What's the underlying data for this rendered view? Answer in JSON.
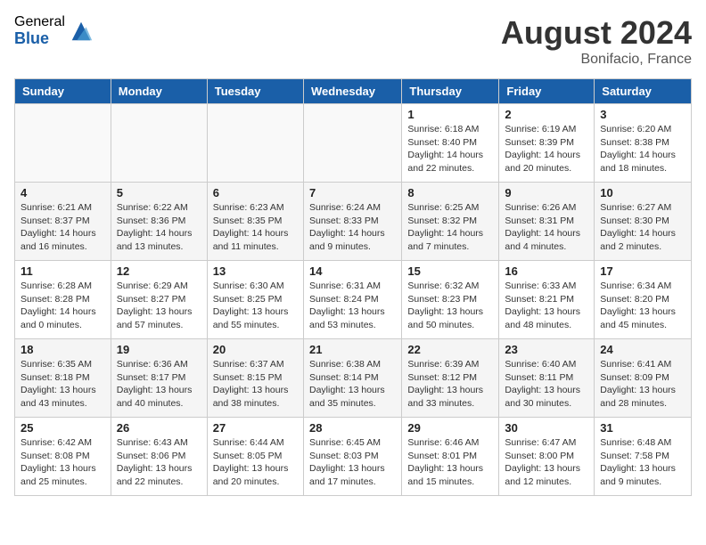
{
  "header": {
    "logo_general": "General",
    "logo_blue": "Blue",
    "month_year": "August 2024",
    "location": "Bonifacio, France"
  },
  "days_of_week": [
    "Sunday",
    "Monday",
    "Tuesday",
    "Wednesday",
    "Thursday",
    "Friday",
    "Saturday"
  ],
  "weeks": [
    [
      {
        "day": "",
        "info": ""
      },
      {
        "day": "",
        "info": ""
      },
      {
        "day": "",
        "info": ""
      },
      {
        "day": "",
        "info": ""
      },
      {
        "day": "1",
        "info": "Sunrise: 6:18 AM\nSunset: 8:40 PM\nDaylight: 14 hours\nand 22 minutes."
      },
      {
        "day": "2",
        "info": "Sunrise: 6:19 AM\nSunset: 8:39 PM\nDaylight: 14 hours\nand 20 minutes."
      },
      {
        "day": "3",
        "info": "Sunrise: 6:20 AM\nSunset: 8:38 PM\nDaylight: 14 hours\nand 18 minutes."
      }
    ],
    [
      {
        "day": "4",
        "info": "Sunrise: 6:21 AM\nSunset: 8:37 PM\nDaylight: 14 hours\nand 16 minutes."
      },
      {
        "day": "5",
        "info": "Sunrise: 6:22 AM\nSunset: 8:36 PM\nDaylight: 14 hours\nand 13 minutes."
      },
      {
        "day": "6",
        "info": "Sunrise: 6:23 AM\nSunset: 8:35 PM\nDaylight: 14 hours\nand 11 minutes."
      },
      {
        "day": "7",
        "info": "Sunrise: 6:24 AM\nSunset: 8:33 PM\nDaylight: 14 hours\nand 9 minutes."
      },
      {
        "day": "8",
        "info": "Sunrise: 6:25 AM\nSunset: 8:32 PM\nDaylight: 14 hours\nand 7 minutes."
      },
      {
        "day": "9",
        "info": "Sunrise: 6:26 AM\nSunset: 8:31 PM\nDaylight: 14 hours\nand 4 minutes."
      },
      {
        "day": "10",
        "info": "Sunrise: 6:27 AM\nSunset: 8:30 PM\nDaylight: 14 hours\nand 2 minutes."
      }
    ],
    [
      {
        "day": "11",
        "info": "Sunrise: 6:28 AM\nSunset: 8:28 PM\nDaylight: 14 hours\nand 0 minutes."
      },
      {
        "day": "12",
        "info": "Sunrise: 6:29 AM\nSunset: 8:27 PM\nDaylight: 13 hours\nand 57 minutes."
      },
      {
        "day": "13",
        "info": "Sunrise: 6:30 AM\nSunset: 8:25 PM\nDaylight: 13 hours\nand 55 minutes."
      },
      {
        "day": "14",
        "info": "Sunrise: 6:31 AM\nSunset: 8:24 PM\nDaylight: 13 hours\nand 53 minutes."
      },
      {
        "day": "15",
        "info": "Sunrise: 6:32 AM\nSunset: 8:23 PM\nDaylight: 13 hours\nand 50 minutes."
      },
      {
        "day": "16",
        "info": "Sunrise: 6:33 AM\nSunset: 8:21 PM\nDaylight: 13 hours\nand 48 minutes."
      },
      {
        "day": "17",
        "info": "Sunrise: 6:34 AM\nSunset: 8:20 PM\nDaylight: 13 hours\nand 45 minutes."
      }
    ],
    [
      {
        "day": "18",
        "info": "Sunrise: 6:35 AM\nSunset: 8:18 PM\nDaylight: 13 hours\nand 43 minutes."
      },
      {
        "day": "19",
        "info": "Sunrise: 6:36 AM\nSunset: 8:17 PM\nDaylight: 13 hours\nand 40 minutes."
      },
      {
        "day": "20",
        "info": "Sunrise: 6:37 AM\nSunset: 8:15 PM\nDaylight: 13 hours\nand 38 minutes."
      },
      {
        "day": "21",
        "info": "Sunrise: 6:38 AM\nSunset: 8:14 PM\nDaylight: 13 hours\nand 35 minutes."
      },
      {
        "day": "22",
        "info": "Sunrise: 6:39 AM\nSunset: 8:12 PM\nDaylight: 13 hours\nand 33 minutes."
      },
      {
        "day": "23",
        "info": "Sunrise: 6:40 AM\nSunset: 8:11 PM\nDaylight: 13 hours\nand 30 minutes."
      },
      {
        "day": "24",
        "info": "Sunrise: 6:41 AM\nSunset: 8:09 PM\nDaylight: 13 hours\nand 28 minutes."
      }
    ],
    [
      {
        "day": "25",
        "info": "Sunrise: 6:42 AM\nSunset: 8:08 PM\nDaylight: 13 hours\nand 25 minutes."
      },
      {
        "day": "26",
        "info": "Sunrise: 6:43 AM\nSunset: 8:06 PM\nDaylight: 13 hours\nand 22 minutes."
      },
      {
        "day": "27",
        "info": "Sunrise: 6:44 AM\nSunset: 8:05 PM\nDaylight: 13 hours\nand 20 minutes."
      },
      {
        "day": "28",
        "info": "Sunrise: 6:45 AM\nSunset: 8:03 PM\nDaylight: 13 hours\nand 17 minutes."
      },
      {
        "day": "29",
        "info": "Sunrise: 6:46 AM\nSunset: 8:01 PM\nDaylight: 13 hours\nand 15 minutes."
      },
      {
        "day": "30",
        "info": "Sunrise: 6:47 AM\nSunset: 8:00 PM\nDaylight: 13 hours\nand 12 minutes."
      },
      {
        "day": "31",
        "info": "Sunrise: 6:48 AM\nSunset: 7:58 PM\nDaylight: 13 hours\nand 9 minutes."
      }
    ]
  ]
}
